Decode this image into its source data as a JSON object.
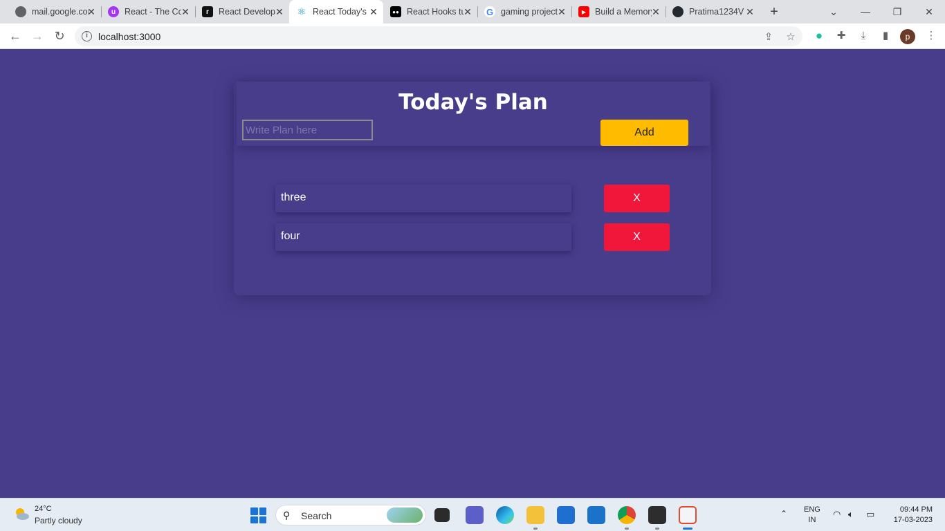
{
  "browser": {
    "tabs": [
      {
        "title": "mail.google.com",
        "favicon": "globe-icon",
        "color": "#5f6368"
      },
      {
        "title": "React - The Complete Guide",
        "favicon": "udemy-icon",
        "color": "#a435f0"
      },
      {
        "title": "React Developer Roadmap",
        "favicon": "roadmap-icon",
        "color": "#111111"
      },
      {
        "title": "React Today's Plan",
        "favicon": "react-icon",
        "color": "#149eca",
        "active": true
      },
      {
        "title": "React Hooks tutorial",
        "favicon": "medium-icon",
        "color": "#000000"
      },
      {
        "title": "gaming project ideas",
        "favicon": "google-icon",
        "color": "#4285f4"
      },
      {
        "title": "Build a Memory Game",
        "favicon": "youtube-icon",
        "color": "#ff0000"
      },
      {
        "title": "Pratima1234V",
        "favicon": "github-icon",
        "color": "#24292f"
      }
    ],
    "url": "localhost:3000",
    "profile_initial": "p"
  },
  "app": {
    "title": "Today's Plan",
    "input_placeholder": "Write Plan here",
    "add_label": "Add",
    "items": [
      {
        "text": "three",
        "delete_label": "X"
      },
      {
        "text": "four",
        "delete_label": "X"
      }
    ],
    "colors": {
      "background": "#483d8b",
      "add_button": "#ffbb00",
      "delete_button": "#f0173b"
    }
  },
  "taskbar": {
    "weather_temp": "24°C",
    "weather_desc": "Partly cloudy",
    "search_label": "Search",
    "lang_line1": "ENG",
    "lang_line2": "IN",
    "time": "09:44 PM",
    "date": "17-03-2023"
  }
}
